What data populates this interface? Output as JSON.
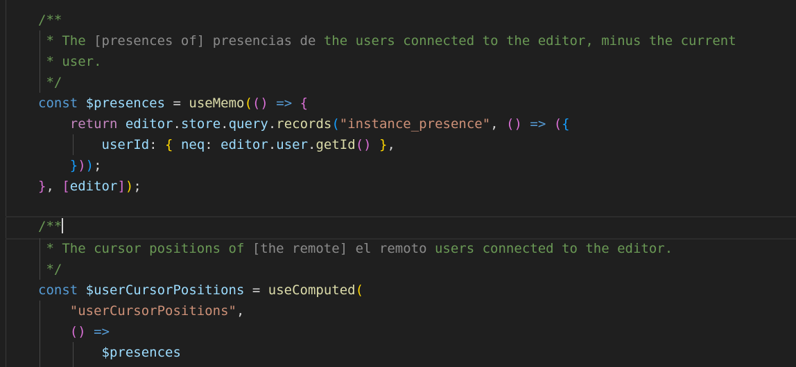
{
  "editor": {
    "colors": {
      "background": "#1f1f1f",
      "comment": "#6a9955",
      "keyword": "#569cd6",
      "control": "#c586c0",
      "variable": "#9cdcfe",
      "function": "#dcdcaa",
      "string": "#ce9178"
    },
    "lines": [
      {
        "tokens": [
          {
            "t": "/**",
            "k": "comment"
          }
        ]
      },
      {
        "tokens": [
          {
            "t": " * The ",
            "k": "comment"
          },
          {
            "t": "[presences of]",
            "k": "strike"
          },
          {
            "t": " ",
            "k": "comment"
          },
          {
            "t": "presencias de",
            "k": "strike"
          },
          {
            "t": " the users connected to the editor, minus the current",
            "k": "comment"
          }
        ]
      },
      {
        "tokens": [
          {
            "t": " * user.",
            "k": "comment"
          }
        ]
      },
      {
        "tokens": [
          {
            "t": " */",
            "k": "comment"
          }
        ]
      },
      {
        "tokens": [
          {
            "t": "const",
            "k": "keyword"
          },
          {
            "t": " ",
            "k": "punc"
          },
          {
            "t": "$presences",
            "k": "var"
          },
          {
            "t": " = ",
            "k": "punc"
          },
          {
            "t": "useMemo",
            "k": "func"
          },
          {
            "t": "(",
            "k": "b1"
          },
          {
            "t": "()",
            "k": "b2"
          },
          {
            "t": " ",
            "k": "punc"
          },
          {
            "t": "=>",
            "k": "keyword"
          },
          {
            "t": " ",
            "k": "punc"
          },
          {
            "t": "{",
            "k": "b2"
          }
        ]
      },
      {
        "tokens": [
          {
            "t": "    ",
            "k": "punc"
          },
          {
            "t": "return",
            "k": "control"
          },
          {
            "t": " ",
            "k": "punc"
          },
          {
            "t": "editor",
            "k": "var"
          },
          {
            "t": ".",
            "k": "punc"
          },
          {
            "t": "store",
            "k": "var"
          },
          {
            "t": ".",
            "k": "punc"
          },
          {
            "t": "query",
            "k": "var"
          },
          {
            "t": ".",
            "k": "punc"
          },
          {
            "t": "records",
            "k": "func"
          },
          {
            "t": "(",
            "k": "b3"
          },
          {
            "t": "\"instance_presence\"",
            "k": "string"
          },
          {
            "t": ", ",
            "k": "punc"
          },
          {
            "t": "()",
            "k": "b2"
          },
          {
            "t": " ",
            "k": "punc"
          },
          {
            "t": "=>",
            "k": "keyword"
          },
          {
            "t": " ",
            "k": "punc"
          },
          {
            "t": "(",
            "k": "b2"
          },
          {
            "t": "{",
            "k": "b3"
          }
        ]
      },
      {
        "tokens": [
          {
            "t": "        ",
            "k": "punc"
          },
          {
            "t": "userId",
            "k": "var"
          },
          {
            "t": ": ",
            "k": "punc"
          },
          {
            "t": "{",
            "k": "b1"
          },
          {
            "t": " ",
            "k": "punc"
          },
          {
            "t": "neq",
            "k": "var"
          },
          {
            "t": ": ",
            "k": "punc"
          },
          {
            "t": "editor",
            "k": "var"
          },
          {
            "t": ".",
            "k": "punc"
          },
          {
            "t": "user",
            "k": "var"
          },
          {
            "t": ".",
            "k": "punc"
          },
          {
            "t": "getId",
            "k": "func"
          },
          {
            "t": "()",
            "k": "b2"
          },
          {
            "t": " ",
            "k": "punc"
          },
          {
            "t": "}",
            "k": "b1"
          },
          {
            "t": ",",
            "k": "punc"
          }
        ]
      },
      {
        "tokens": [
          {
            "t": "    ",
            "k": "punc"
          },
          {
            "t": "}",
            "k": "b3"
          },
          {
            "t": ")",
            "k": "b2"
          },
          {
            "t": ")",
            "k": "b3"
          },
          {
            "t": ";",
            "k": "punc"
          }
        ]
      },
      {
        "tokens": [
          {
            "t": "}",
            "k": "b2"
          },
          {
            "t": ", ",
            "k": "punc"
          },
          {
            "t": "[",
            "k": "b2"
          },
          {
            "t": "editor",
            "k": "var"
          },
          {
            "t": "]",
            "k": "b2"
          },
          {
            "t": ")",
            "k": "b1"
          },
          {
            "t": ";",
            "k": "punc"
          }
        ]
      },
      {
        "tokens": []
      },
      {
        "current": true,
        "tokens": [
          {
            "t": "/**",
            "k": "comment"
          }
        ]
      },
      {
        "tokens": [
          {
            "t": " * The cursor positions of ",
            "k": "comment"
          },
          {
            "t": "[the remote]",
            "k": "strike"
          },
          {
            "t": " ",
            "k": "comment"
          },
          {
            "t": "el remoto",
            "k": "strike"
          },
          {
            "t": " users connected to the editor.",
            "k": "comment"
          }
        ]
      },
      {
        "tokens": [
          {
            "t": " */",
            "k": "comment"
          }
        ]
      },
      {
        "tokens": [
          {
            "t": "const",
            "k": "keyword"
          },
          {
            "t": " ",
            "k": "punc"
          },
          {
            "t": "$userCursorPositions",
            "k": "var"
          },
          {
            "t": " = ",
            "k": "punc"
          },
          {
            "t": "useComputed",
            "k": "func"
          },
          {
            "t": "(",
            "k": "b1"
          }
        ]
      },
      {
        "tokens": [
          {
            "t": "    ",
            "k": "punc"
          },
          {
            "t": "\"userCursorPositions\"",
            "k": "string"
          },
          {
            "t": ",",
            "k": "punc"
          }
        ]
      },
      {
        "tokens": [
          {
            "t": "    ",
            "k": "punc"
          },
          {
            "t": "()",
            "k": "b2"
          },
          {
            "t": " ",
            "k": "punc"
          },
          {
            "t": "=>",
            "k": "keyword"
          }
        ]
      },
      {
        "tokens": [
          {
            "t": "        ",
            "k": "punc"
          },
          {
            "t": "$presences",
            "k": "var"
          }
        ]
      }
    ]
  }
}
